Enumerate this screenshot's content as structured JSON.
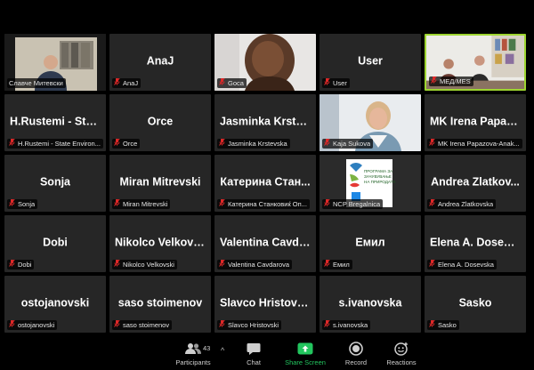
{
  "tiles": [
    {
      "name": "",
      "tag": "Славче Митевски",
      "video": "room",
      "muted": false
    },
    {
      "name": "AnaJ",
      "tag": "AnaJ",
      "muted": true
    },
    {
      "name": "",
      "tag": "Gоса",
      "video": "person-hair",
      "muted": true
    },
    {
      "name": "User",
      "tag": "User",
      "muted": true
    },
    {
      "name": "",
      "tag": "МЕД/MES",
      "video": "office",
      "muted": true,
      "active": true
    },
    {
      "name": "H.Rustemi - State ...",
      "tag": "H.Rustemi - State Environ...",
      "muted": true
    },
    {
      "name": "Orce",
      "tag": "Orce",
      "muted": true
    },
    {
      "name": "Jasminka Krste...",
      "tag": "Jasminka Krstevska",
      "muted": true
    },
    {
      "name": "",
      "tag": "Kaja Sukova",
      "video": "woman",
      "muted": true
    },
    {
      "name": "MK Irena Papazo...",
      "tag": "MK Irena Papazova-Anak...",
      "muted": true
    },
    {
      "name": "Sonja",
      "tag": "Sonja",
      "muted": true
    },
    {
      "name": "Miran Mitrevski",
      "tag": "Miran Mitrevski",
      "muted": true
    },
    {
      "name": "Катерина Стан...",
      "tag": "Катерина Станковиќ Оп...",
      "muted": true
    },
    {
      "name": "",
      "tag": "NCP Bregalnica",
      "video": "logo",
      "muted": true
    },
    {
      "name": "Andrea Zlatkov...",
      "tag": "Andrea Zlatkovska",
      "muted": true
    },
    {
      "name": "Dobi",
      "tag": "Dobi",
      "muted": true
    },
    {
      "name": "Nikolco Velkovski",
      "tag": "Nikolco Velkovski",
      "muted": true
    },
    {
      "name": "Valentina Cavda...",
      "tag": "Valentina Cavdarova",
      "muted": true
    },
    {
      "name": "Емил",
      "tag": "Емил",
      "muted": true
    },
    {
      "name": "Elena A. Dosevs...",
      "tag": "Elena A. Dosevska",
      "muted": true
    },
    {
      "name": "ostojanovski",
      "tag": "ostojanovski",
      "muted": true
    },
    {
      "name": "saso stoimenov",
      "tag": "saso stoimenov",
      "muted": true
    },
    {
      "name": "Slavco Hristovski",
      "tag": "Slavco Hristovski",
      "muted": true
    },
    {
      "name": "s.ivanovska",
      "tag": "s.ivanovska",
      "muted": true
    },
    {
      "name": "Sasko",
      "tag": "Sasko",
      "muted": true
    }
  ],
  "logo_text": [
    "ПРОГРАМА ЗА",
    "ЗАЧУВУВАЊЕ",
    "НА ПРИРОДАТА"
  ],
  "toolbar": {
    "participants_label": "Participants",
    "participants_count": "43",
    "chat_label": "Chat",
    "share_label": "Share Screen",
    "record_label": "Record",
    "reactions_label": "Reactions"
  },
  "colors": {
    "active_border": "#9dd430",
    "share_green": "#22c55e",
    "muted_red": "#e02828",
    "tile_bg": "#262626"
  }
}
